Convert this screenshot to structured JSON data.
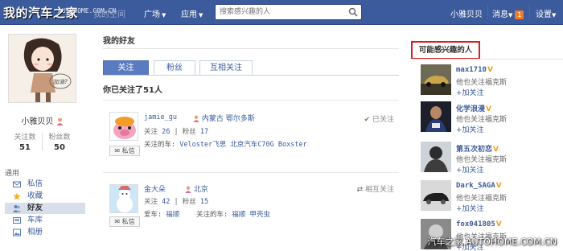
{
  "topbar": {
    "logo_text": "我的汽车之家",
    "logo_sub": "AUTOHOME.COM.CN",
    "nav_ghost": "我的空间",
    "nav": [
      {
        "label": "广场"
      },
      {
        "label": "应用"
      }
    ],
    "search_placeholder": "搜索感兴趣的人",
    "username": "小雅贝贝",
    "messages_label": "消息",
    "messages_count": "1",
    "settings_label": "设置"
  },
  "profile": {
    "name": "小雅贝贝",
    "avatar_text": "加油?",
    "stats": [
      {
        "label": "关注数",
        "value": "51"
      },
      {
        "label": "粉丝数",
        "value": "50"
      }
    ]
  },
  "sidebar": {
    "section": "通用",
    "items": [
      {
        "label": "私信",
        "icon": "mail-icon"
      },
      {
        "label": "收藏",
        "icon": "star-icon"
      },
      {
        "label": "好友",
        "icon": "friends-icon",
        "active": true
      },
      {
        "label": "车库",
        "icon": "garage-icon"
      },
      {
        "label": "相册",
        "icon": "album-icon"
      }
    ]
  },
  "main": {
    "title": "我的好友",
    "tabs": [
      {
        "label": "关注",
        "active": true
      },
      {
        "label": "粉丝"
      },
      {
        "label": "互相关注"
      }
    ],
    "count_text": "你已关注了51人",
    "rows": [
      {
        "name": "jamie_gu",
        "location": "内蒙古 鄂尔多斯",
        "follow_label": "关注",
        "follow_count": "26",
        "fans_label": "粉丝",
        "fans_count": "17",
        "car_label": "关注的车:",
        "cars": "Veloster飞思 北京汽车C70G Boxster",
        "status": "已关注",
        "msg": "私信"
      },
      {
        "name": "金大朵",
        "location": "北京",
        "follow_label": "关注",
        "follow_count": "42",
        "fans_label": "粉丝",
        "fans_count": "15",
        "own_car_label": "爱车:",
        "own_car": "福顺",
        "car_label": "关注的车:",
        "cars": "福顺 甲壳虫",
        "status": "相互关注",
        "msg": "私信"
      }
    ]
  },
  "suggestions": {
    "title": "可能感兴趣的人",
    "items": [
      {
        "name": "max1710",
        "desc": "他也关注福克斯",
        "add": "加关注"
      },
      {
        "name": "化学浪漫",
        "desc": "他也关注福克斯",
        "add": "加关注"
      },
      {
        "name": "第五次初恋",
        "desc": "他也关注福克斯",
        "add": "加关注"
      },
      {
        "name": "Dark_SAGA",
        "desc": "他也关注福克斯",
        "add": "加关注"
      },
      {
        "name": "fox041805",
        "desc": "他也关注福克斯",
        "add": "加关注"
      }
    ]
  },
  "watermark": "汽车之家 AUTOHOME.COM.CN",
  "colors": {
    "topbar": "#3b5b9c",
    "link": "#3b5b9c",
    "tab_active": "#5b7bc0",
    "highlight_box": "#d22222",
    "badge": "#f47920"
  }
}
